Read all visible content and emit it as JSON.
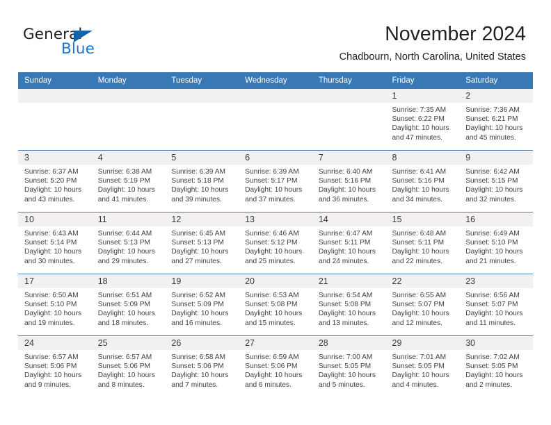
{
  "brand": {
    "name_part1": "General",
    "name_part2": "Blue",
    "triangle_color": "#1464aa",
    "blue_color": "#1b76d0"
  },
  "header": {
    "month_title": "November 2024",
    "location": "Chadbourn, North Carolina, United States"
  },
  "calendar": {
    "header_bg": "#3878b4",
    "daynum_bg": "#f1f1f1",
    "weekdays": [
      "Sunday",
      "Monday",
      "Tuesday",
      "Wednesday",
      "Thursday",
      "Friday",
      "Saturday"
    ],
    "weeks": [
      [
        {
          "empty": true
        },
        {
          "empty": true
        },
        {
          "empty": true
        },
        {
          "empty": true
        },
        {
          "empty": true
        },
        {
          "day": "1",
          "sunrise": "Sunrise: 7:35 AM",
          "sunset": "Sunset: 6:22 PM",
          "daylight1": "Daylight: 10 hours",
          "daylight2": "and 47 minutes."
        },
        {
          "day": "2",
          "sunrise": "Sunrise: 7:36 AM",
          "sunset": "Sunset: 6:21 PM",
          "daylight1": "Daylight: 10 hours",
          "daylight2": "and 45 minutes."
        }
      ],
      [
        {
          "day": "3",
          "sunrise": "Sunrise: 6:37 AM",
          "sunset": "Sunset: 5:20 PM",
          "daylight1": "Daylight: 10 hours",
          "daylight2": "and 43 minutes."
        },
        {
          "day": "4",
          "sunrise": "Sunrise: 6:38 AM",
          "sunset": "Sunset: 5:19 PM",
          "daylight1": "Daylight: 10 hours",
          "daylight2": "and 41 minutes."
        },
        {
          "day": "5",
          "sunrise": "Sunrise: 6:39 AM",
          "sunset": "Sunset: 5:18 PM",
          "daylight1": "Daylight: 10 hours",
          "daylight2": "and 39 minutes."
        },
        {
          "day": "6",
          "sunrise": "Sunrise: 6:39 AM",
          "sunset": "Sunset: 5:17 PM",
          "daylight1": "Daylight: 10 hours",
          "daylight2": "and 37 minutes."
        },
        {
          "day": "7",
          "sunrise": "Sunrise: 6:40 AM",
          "sunset": "Sunset: 5:16 PM",
          "daylight1": "Daylight: 10 hours",
          "daylight2": "and 36 minutes."
        },
        {
          "day": "8",
          "sunrise": "Sunrise: 6:41 AM",
          "sunset": "Sunset: 5:16 PM",
          "daylight1": "Daylight: 10 hours",
          "daylight2": "and 34 minutes."
        },
        {
          "day": "9",
          "sunrise": "Sunrise: 6:42 AM",
          "sunset": "Sunset: 5:15 PM",
          "daylight1": "Daylight: 10 hours",
          "daylight2": "and 32 minutes."
        }
      ],
      [
        {
          "day": "10",
          "sunrise": "Sunrise: 6:43 AM",
          "sunset": "Sunset: 5:14 PM",
          "daylight1": "Daylight: 10 hours",
          "daylight2": "and 30 minutes."
        },
        {
          "day": "11",
          "sunrise": "Sunrise: 6:44 AM",
          "sunset": "Sunset: 5:13 PM",
          "daylight1": "Daylight: 10 hours",
          "daylight2": "and 29 minutes."
        },
        {
          "day": "12",
          "sunrise": "Sunrise: 6:45 AM",
          "sunset": "Sunset: 5:13 PM",
          "daylight1": "Daylight: 10 hours",
          "daylight2": "and 27 minutes."
        },
        {
          "day": "13",
          "sunrise": "Sunrise: 6:46 AM",
          "sunset": "Sunset: 5:12 PM",
          "daylight1": "Daylight: 10 hours",
          "daylight2": "and 25 minutes."
        },
        {
          "day": "14",
          "sunrise": "Sunrise: 6:47 AM",
          "sunset": "Sunset: 5:11 PM",
          "daylight1": "Daylight: 10 hours",
          "daylight2": "and 24 minutes."
        },
        {
          "day": "15",
          "sunrise": "Sunrise: 6:48 AM",
          "sunset": "Sunset: 5:11 PM",
          "daylight1": "Daylight: 10 hours",
          "daylight2": "and 22 minutes."
        },
        {
          "day": "16",
          "sunrise": "Sunrise: 6:49 AM",
          "sunset": "Sunset: 5:10 PM",
          "daylight1": "Daylight: 10 hours",
          "daylight2": "and 21 minutes."
        }
      ],
      [
        {
          "day": "17",
          "sunrise": "Sunrise: 6:50 AM",
          "sunset": "Sunset: 5:10 PM",
          "daylight1": "Daylight: 10 hours",
          "daylight2": "and 19 minutes."
        },
        {
          "day": "18",
          "sunrise": "Sunrise: 6:51 AM",
          "sunset": "Sunset: 5:09 PM",
          "daylight1": "Daylight: 10 hours",
          "daylight2": "and 18 minutes."
        },
        {
          "day": "19",
          "sunrise": "Sunrise: 6:52 AM",
          "sunset": "Sunset: 5:09 PM",
          "daylight1": "Daylight: 10 hours",
          "daylight2": "and 16 minutes."
        },
        {
          "day": "20",
          "sunrise": "Sunrise: 6:53 AM",
          "sunset": "Sunset: 5:08 PM",
          "daylight1": "Daylight: 10 hours",
          "daylight2": "and 15 minutes."
        },
        {
          "day": "21",
          "sunrise": "Sunrise: 6:54 AM",
          "sunset": "Sunset: 5:08 PM",
          "daylight1": "Daylight: 10 hours",
          "daylight2": "and 13 minutes."
        },
        {
          "day": "22",
          "sunrise": "Sunrise: 6:55 AM",
          "sunset": "Sunset: 5:07 PM",
          "daylight1": "Daylight: 10 hours",
          "daylight2": "and 12 minutes."
        },
        {
          "day": "23",
          "sunrise": "Sunrise: 6:56 AM",
          "sunset": "Sunset: 5:07 PM",
          "daylight1": "Daylight: 10 hours",
          "daylight2": "and 11 minutes."
        }
      ],
      [
        {
          "day": "24",
          "sunrise": "Sunrise: 6:57 AM",
          "sunset": "Sunset: 5:06 PM",
          "daylight1": "Daylight: 10 hours",
          "daylight2": "and 9 minutes."
        },
        {
          "day": "25",
          "sunrise": "Sunrise: 6:57 AM",
          "sunset": "Sunset: 5:06 PM",
          "daylight1": "Daylight: 10 hours",
          "daylight2": "and 8 minutes."
        },
        {
          "day": "26",
          "sunrise": "Sunrise: 6:58 AM",
          "sunset": "Sunset: 5:06 PM",
          "daylight1": "Daylight: 10 hours",
          "daylight2": "and 7 minutes."
        },
        {
          "day": "27",
          "sunrise": "Sunrise: 6:59 AM",
          "sunset": "Sunset: 5:06 PM",
          "daylight1": "Daylight: 10 hours",
          "daylight2": "and 6 minutes."
        },
        {
          "day": "28",
          "sunrise": "Sunrise: 7:00 AM",
          "sunset": "Sunset: 5:05 PM",
          "daylight1": "Daylight: 10 hours",
          "daylight2": "and 5 minutes."
        },
        {
          "day": "29",
          "sunrise": "Sunrise: 7:01 AM",
          "sunset": "Sunset: 5:05 PM",
          "daylight1": "Daylight: 10 hours",
          "daylight2": "and 4 minutes."
        },
        {
          "day": "30",
          "sunrise": "Sunrise: 7:02 AM",
          "sunset": "Sunset: 5:05 PM",
          "daylight1": "Daylight: 10 hours",
          "daylight2": "and 2 minutes."
        }
      ]
    ]
  }
}
